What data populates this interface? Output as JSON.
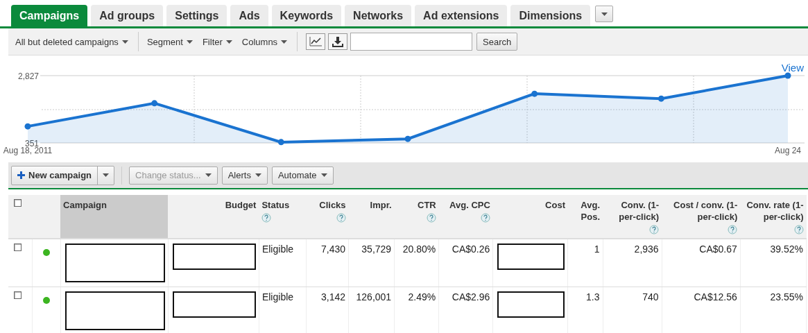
{
  "tabs": [
    {
      "label": "Campaigns",
      "selected": true
    },
    {
      "label": "Ad groups",
      "selected": false
    },
    {
      "label": "Settings",
      "selected": false
    },
    {
      "label": "Ads",
      "selected": false
    },
    {
      "label": "Keywords",
      "selected": false
    },
    {
      "label": "Networks",
      "selected": false
    },
    {
      "label": "Ad extensions",
      "selected": false
    },
    {
      "label": "Dimensions",
      "selected": false
    }
  ],
  "toolbar": {
    "view_filter": "All but deleted campaigns",
    "menus": [
      "Segment",
      "Filter",
      "Columns"
    ],
    "search_button": "Search"
  },
  "chart": {
    "view_link": "View",
    "chart_data": {
      "type": "area",
      "categories": [
        "Aug 18, 2011",
        null,
        null,
        null,
        null,
        null,
        "Aug 24"
      ],
      "series": [
        {
          "color": "#1a73d0",
          "values": [
            960,
            1810,
            380,
            500,
            2160,
            1980,
            2827
          ]
        }
      ],
      "ylim": [
        351,
        2827
      ],
      "yticks": [
        {
          "value": 351,
          "label": "351"
        },
        {
          "value": 2827,
          "label": "2,827"
        }
      ]
    }
  },
  "actions": {
    "new_campaign": "New campaign",
    "buttons": [
      {
        "label": "Change status...",
        "disabled": true
      },
      {
        "label": "Alerts",
        "disabled": false
      },
      {
        "label": "Automate",
        "disabled": false
      }
    ]
  },
  "table": {
    "all_checked": false,
    "columns": [
      {
        "label": "Campaign",
        "help": false,
        "sorted": true
      },
      {
        "label": "Budget",
        "help": false,
        "sorted": false
      },
      {
        "label": "Status",
        "help": true,
        "sorted": false
      },
      {
        "label": "Clicks",
        "help": true,
        "sorted": false
      },
      {
        "label": "Impr.",
        "help": false,
        "sorted": false
      },
      {
        "label": "CTR",
        "help": true,
        "sorted": false
      },
      {
        "label": "Avg. CPC",
        "help": true,
        "sorted": false
      },
      {
        "label": "Cost",
        "help": false,
        "sorted": false
      },
      {
        "label": "Avg. Pos.",
        "help": false,
        "sorted": false
      },
      {
        "label": "Conv. (1-per-click)",
        "help": true,
        "sorted": false
      },
      {
        "label": "Cost / conv. (1-per-click)",
        "help": true,
        "sorted": false
      },
      {
        "label": "Conv. rate (1-per-click)",
        "help": true,
        "sorted": false
      }
    ],
    "rows": [
      {
        "checked": false,
        "color": "#3cb521",
        "cells": [
          {
            "kind": "redacted"
          },
          {
            "kind": "redacted"
          },
          {
            "kind": "text",
            "text": "Eligible"
          },
          {
            "kind": "text",
            "text": "7,430"
          },
          {
            "kind": "text",
            "text": "35,729"
          },
          {
            "kind": "text",
            "text": "20.80%"
          },
          {
            "kind": "text",
            "text": "CA$0.26"
          },
          {
            "kind": "redacted"
          },
          {
            "kind": "text",
            "text": "1"
          },
          {
            "kind": "text",
            "text": "2,936"
          },
          {
            "kind": "text",
            "text": "CA$0.67"
          },
          {
            "kind": "text",
            "text": "39.52%"
          }
        ]
      },
      {
        "checked": false,
        "color": "#3cb521",
        "cells": [
          {
            "kind": "redacted"
          },
          {
            "kind": "redacted"
          },
          {
            "kind": "text",
            "text": "Eligible"
          },
          {
            "kind": "text",
            "text": "3,142"
          },
          {
            "kind": "text",
            "text": "126,001"
          },
          {
            "kind": "text",
            "text": "2.49%"
          },
          {
            "kind": "text",
            "text": "CA$2.96"
          },
          {
            "kind": "redacted"
          },
          {
            "kind": "text",
            "text": "1.3"
          },
          {
            "kind": "text",
            "text": "740"
          },
          {
            "kind": "text",
            "text": "CA$12.56"
          },
          {
            "kind": "text",
            "text": "23.55%"
          }
        ]
      }
    ]
  }
}
